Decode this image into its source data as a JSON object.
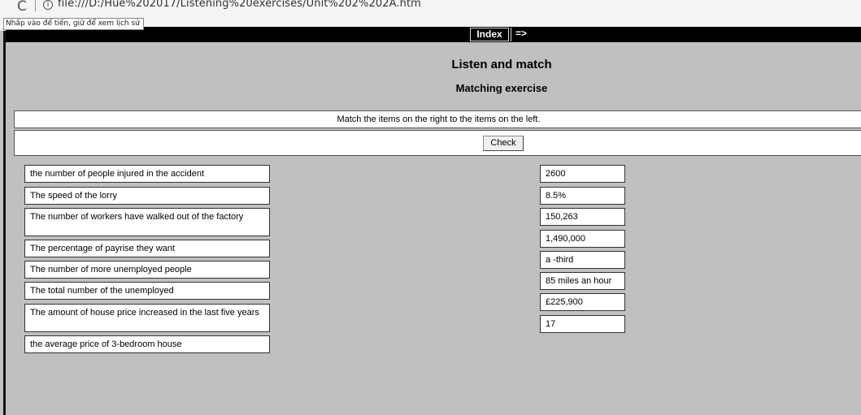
{
  "browser": {
    "reload_glyph": "C",
    "info_glyph": "i",
    "url": "file:///D:/Hue%202017/Listening%20exercises/Unit%202%202A.htm",
    "tooltip": "Nhấp vào để tiến, giữ để xem lịch sử"
  },
  "nav": {
    "index_label": "Index",
    "next_label": "=>"
  },
  "title": "Listen and match",
  "subtitle": "Matching exercise",
  "instructions": "Match the items on the right to the items on the left.",
  "check_label": "Check",
  "left_items": [
    "the number of people injured in the accident",
    "The speed of the lorry",
    "The number of workers have walked out of the factory",
    "The percentage of payrise they want",
    "The number of more unemployed people",
    "The total number of the unemployed",
    "The amount of house price increased in the last five years",
    "the average price of 3-bedroom house"
  ],
  "right_items": [
    "2600",
    "8.5%",
    "150,263",
    "1,490,000",
    "a -third",
    "85 miles an hour",
    "£225,900",
    "17"
  ]
}
